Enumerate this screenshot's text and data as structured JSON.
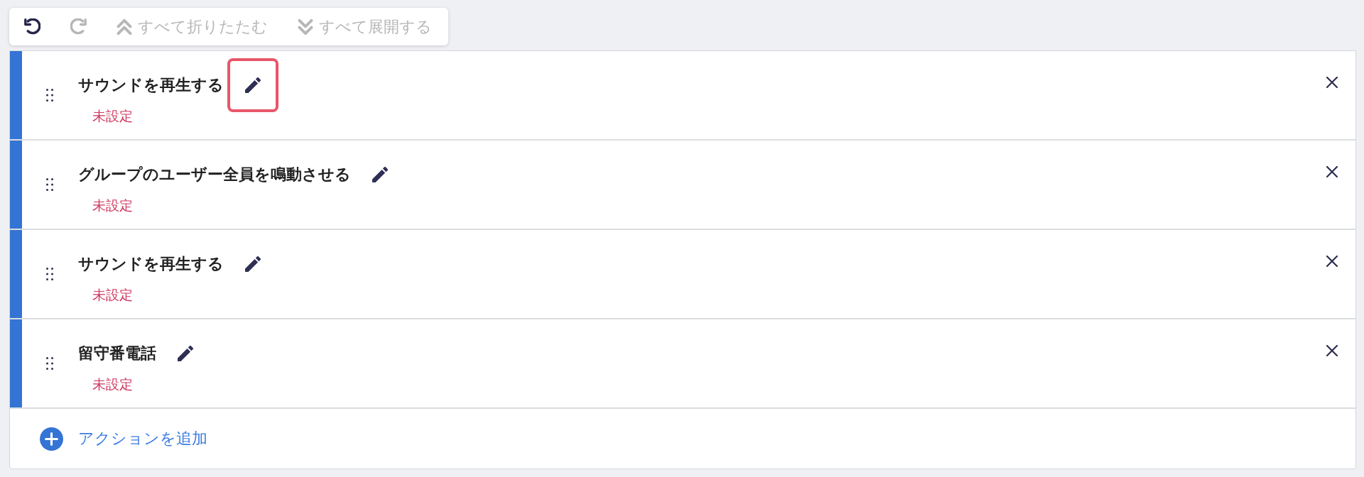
{
  "toolbar": {
    "buttons": [
      {
        "kind": "undo",
        "disabled": false
      },
      {
        "kind": "redo",
        "disabled": true
      },
      {
        "kind": "collapse_all",
        "label": "すべて折りたたむ",
        "disabled": true
      },
      {
        "kind": "expand_all",
        "label": "すべて展開する",
        "disabled": true
      }
    ]
  },
  "actions": [
    {
      "title": "サウンドを再生する",
      "status": "未設定",
      "edit_highlighted": true
    },
    {
      "title": "グループのユーザー全員を鳴動させる",
      "status": "未設定",
      "edit_highlighted": false
    },
    {
      "title": "サウンドを再生する",
      "status": "未設定",
      "edit_highlighted": false
    },
    {
      "title": "留守番電話",
      "status": "未設定",
      "edit_highlighted": false
    }
  ],
  "add_action": {
    "label": "アクションを追加"
  }
}
